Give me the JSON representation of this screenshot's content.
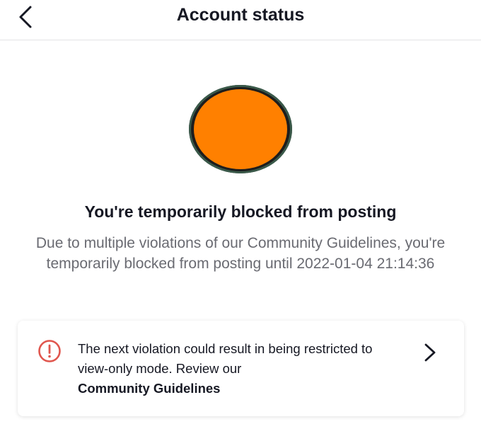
{
  "header": {
    "title": "Account status",
    "back_icon": "chevron-left-icon"
  },
  "main": {
    "avatar_color": "#ff8000",
    "headline": "You're temporarily blocked from posting",
    "description": "Due to multiple violations of our Community Guidelines, you're temporarily blocked from posting until 2022-01-04 21:14:36",
    "notice": {
      "icon": "exclamation-circle-icon",
      "text": "The next violation could result in being restricted to view-only mode. Review our",
      "link_label": "Community Guidelines",
      "chevron_icon": "chevron-right-icon",
      "icon_color": "#e0564e"
    }
  }
}
